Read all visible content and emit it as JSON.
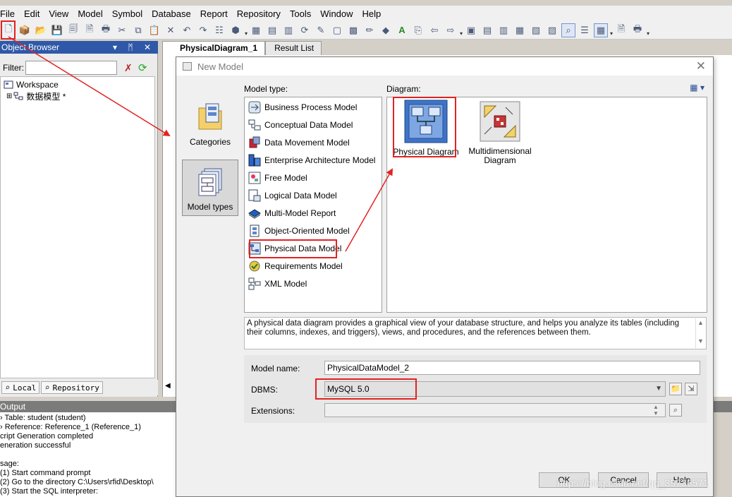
{
  "menubar": {
    "items": [
      "File",
      "Edit",
      "View",
      "Model",
      "Symbol",
      "Database",
      "Report",
      "Repository",
      "Tools",
      "Window",
      "Help"
    ]
  },
  "object_browser": {
    "title": "Object Browser",
    "header_controls": "▾ ᛗ ✕",
    "filter_label": "Filter:",
    "filter_value": "",
    "tree": {
      "workspace": "Workspace",
      "model": "数据模型 *"
    },
    "tabs": [
      "Local",
      "Repository"
    ]
  },
  "document_tabs": [
    "PhysicalDiagram_1",
    "Result List"
  ],
  "output": {
    "title": "Output",
    "lines": [
      "› Table: student (student)",
      "› Reference: Reference_1 (Reference_1)",
      "cript Generation completed",
      "eneration successful",
      "",
      "sage:",
      "(1) Start command prompt",
      "(2) Go to the directory C:\\Users\\rfid\\Desktop\\",
      "(3) Start the SQL interpreter:"
    ]
  },
  "dialog": {
    "title": "New Model",
    "categories": [
      {
        "label": "Categories",
        "selected": false
      },
      {
        "label": "Model types",
        "selected": true
      }
    ],
    "model_type_label": "Model type:",
    "diagram_label": "Diagram:",
    "model_types": [
      "Business Process Model",
      "Conceptual Data Model",
      "Data Movement Model",
      "Enterprise Architecture Model",
      "Free Model",
      "Logical Data Model",
      "Multi-Model Report",
      "Object-Oriented Model",
      "Physical Data Model",
      "Requirements Model",
      "XML Model"
    ],
    "selected_model_type": "Physical Data Model",
    "diagrams": [
      {
        "label": "Physical Diagram",
        "selected": true
      },
      {
        "label": "Multidimensional Diagram",
        "selected": false
      }
    ],
    "description": "A physical data diagram provides a graphical view of your database structure, and helps you analyze its tables (including their columns, indexes, and triggers), views, and procedures, and the references between them.",
    "fields": {
      "model_name_label": "Model name:",
      "model_name_value": "PhysicalDataModel_2",
      "dbms_label": "DBMS:",
      "dbms_value": "MySQL 5.0",
      "extensions_label": "Extensions:",
      "extensions_value": ""
    },
    "buttons": {
      "ok": "OK",
      "cancel": "Cancel",
      "help": "Help"
    }
  },
  "watermark": "https://blog.csdn.net/qq_39736571",
  "colors": {
    "highlight_red": "#e32222",
    "title_blue": "#2f59a8",
    "selection_blue": "#3399ff"
  }
}
